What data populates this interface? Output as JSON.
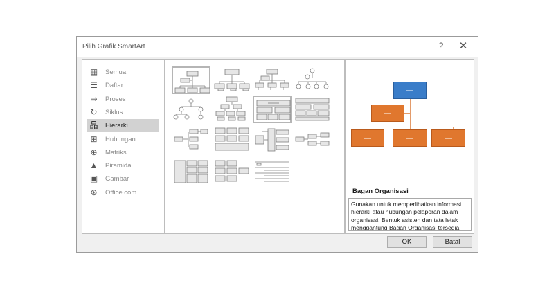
{
  "dialog": {
    "title": "Pilih Grafik SmartArt",
    "help_label": "?",
    "close_label": "✕"
  },
  "categories": [
    {
      "label": "Semua",
      "icon": "all-icon",
      "glyph": "▦",
      "selected": false
    },
    {
      "label": "Daftar",
      "icon": "list-icon",
      "glyph": "☰",
      "selected": false
    },
    {
      "label": "Proses",
      "icon": "process-icon",
      "glyph": "⇛",
      "selected": false
    },
    {
      "label": "Siklus",
      "icon": "cycle-icon",
      "glyph": "↻",
      "selected": false
    },
    {
      "label": "Hierarki",
      "icon": "hierarchy-icon",
      "glyph": "品",
      "selected": true
    },
    {
      "label": "Hubungan",
      "icon": "relationship-icon",
      "glyph": "⊞",
      "selected": false
    },
    {
      "label": "Matriks",
      "icon": "matrix-icon",
      "glyph": "⊕",
      "selected": false
    },
    {
      "label": "Piramida",
      "icon": "pyramid-icon",
      "glyph": "▲",
      "selected": false
    },
    {
      "label": "Gambar",
      "icon": "picture-icon",
      "glyph": "▣",
      "selected": false
    },
    {
      "label": "Office.com",
      "icon": "globe-icon",
      "glyph": "⊛",
      "selected": false
    }
  ],
  "preview": {
    "title": "Bagan Organisasi",
    "description": "Gunakan untuk memperlihatkan informasi hierarki atau hubungan pelaporan dalam organisasi. Bentuk asisten dan tata letak menggantung Bagan Organisasi tersedia dengan tata letak ini.",
    "colors": {
      "top": "#3a7dc9",
      "node": "#e0772e"
    }
  },
  "buttons": {
    "ok": "OK",
    "cancel": "Batal"
  }
}
